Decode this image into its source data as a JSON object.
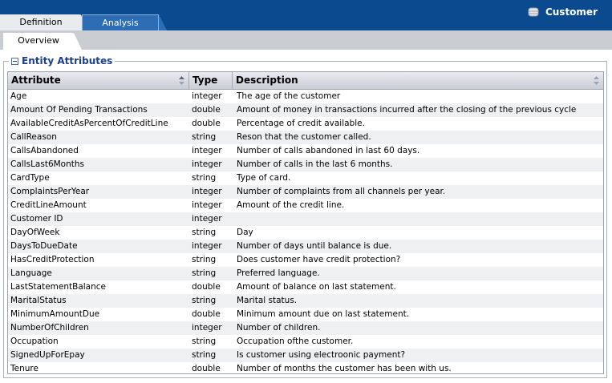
{
  "tabs": {
    "definition": "Definition",
    "analysis": "Analysis"
  },
  "entity": {
    "icon": "database-icon",
    "name": "Customer"
  },
  "subtabs": {
    "overview": "Overview"
  },
  "section": {
    "title": "Entity Attributes",
    "icon": "collapse-icon"
  },
  "table": {
    "columns": [
      "Attribute",
      "Type",
      "Description"
    ],
    "rows": [
      {
        "attribute": "Age",
        "type": "integer",
        "description": "The age of the customer"
      },
      {
        "attribute": "Amount Of Pending Transactions",
        "type": "double",
        "description": "Amount of money in transactions incurred after the closing of the previous cycle"
      },
      {
        "attribute": "AvailableCreditAsPercentOfCreditLine",
        "type": "double",
        "description": "Percentage of credit available."
      },
      {
        "attribute": "CallReason",
        "type": "string",
        "description": "Reson that the customer called."
      },
      {
        "attribute": "CallsAbandoned",
        "type": "integer",
        "description": "Number of calls abandoned in last 60 days."
      },
      {
        "attribute": "CallsLast6Months",
        "type": "integer",
        "description": "Number of calls in the last 6 months."
      },
      {
        "attribute": "CardType",
        "type": "string",
        "description": "Type of card."
      },
      {
        "attribute": "ComplaintsPerYear",
        "type": "integer",
        "description": "Number of complaints from all channels per year."
      },
      {
        "attribute": "CreditLineAmount",
        "type": "integer",
        "description": "Amount of the credit line."
      },
      {
        "attribute": "Customer ID",
        "type": "integer",
        "description": ""
      },
      {
        "attribute": "DayOfWeek",
        "type": "string",
        "description": "Day"
      },
      {
        "attribute": "DaysToDueDate",
        "type": "integer",
        "description": "Number of days until balance is due."
      },
      {
        "attribute": "HasCreditProtection",
        "type": "string",
        "description": "Does customer have credit protection?"
      },
      {
        "attribute": "Language",
        "type": "string",
        "description": "Preferred language."
      },
      {
        "attribute": "LastStatementBalance",
        "type": "double",
        "description": "Amount of balance on last statement."
      },
      {
        "attribute": "MaritalStatus",
        "type": "string",
        "description": "Marital status."
      },
      {
        "attribute": "MinimumAmountDue",
        "type": "double",
        "description": "Minimum amount due on last statement."
      },
      {
        "attribute": "NumberOfChildren",
        "type": "integer",
        "description": "Number of children."
      },
      {
        "attribute": "Occupation",
        "type": "string",
        "description": "Occupation ofthe customer."
      },
      {
        "attribute": "SignedUpForEpay",
        "type": "string",
        "description": "Is customer using electroonic payment?"
      },
      {
        "attribute": "Tenure",
        "type": "double",
        "description": "Number of months the customer has been with us."
      }
    ]
  }
}
